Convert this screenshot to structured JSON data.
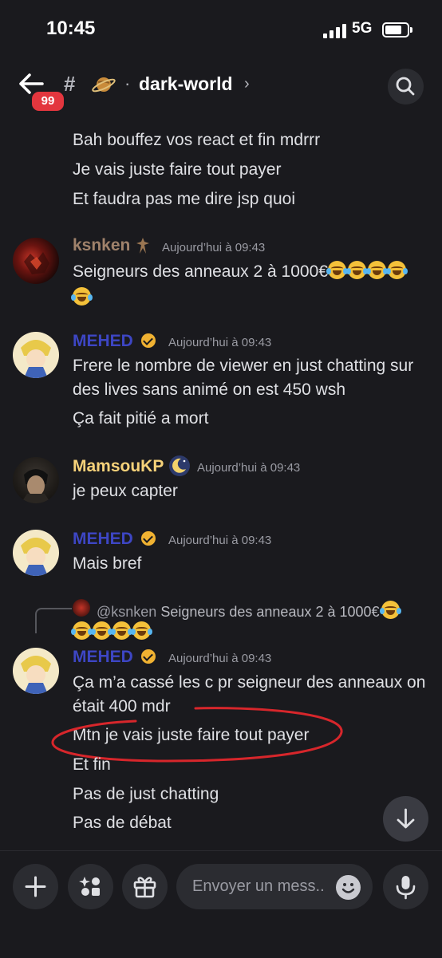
{
  "status_bar": {
    "time": "10:45",
    "network": "5G"
  },
  "header": {
    "unread_badge": "99",
    "channel_name": "dark-world",
    "hash_symbol": "#",
    "separator": "·",
    "chevron": "›"
  },
  "top_lines": [
    "Bah bouffez vos react et fin mdrrr",
    "Je vais juste faire tout payer",
    "Et faudra pas me dire jsp quoi"
  ],
  "messages": [
    {
      "author": "ksnken",
      "author_color": "#a0826b",
      "timestamp": "Aujourd’hui à 09:43",
      "lines": [
        "Seigneurs des anneaux 2 à 1000€"
      ]
    },
    {
      "author": "MEHED",
      "author_color": "#3d46c4",
      "timestamp": "Aujourd’hui à 09:43",
      "lines": [
        "Frere le nombre de viewer en just chatting sur",
        "des lives sans animé on est 450 wsh",
        "Ça fait pitié a mort"
      ]
    },
    {
      "author": "MamsouKP",
      "author_color": "#f6d27a",
      "timestamp": "Aujourd’hui à 09:43",
      "lines": [
        "je peux capter"
      ]
    },
    {
      "author": "MEHED",
      "author_color": "#3d46c4",
      "timestamp": "Aujourd’hui à 09:43",
      "lines": [
        "Mais bref"
      ]
    },
    {
      "author": "MEHED",
      "author_color": "#3d46c4",
      "timestamp": "Aujourd’hui à 09:43",
      "reply": {
        "mention": "@ksnken",
        "text": "Seigneurs des anneaux 2 à 1000€"
      },
      "lines": [
        "Ça m’a cassé les c pr seigneur des anneaux on",
        "était 400 mdr",
        "Mtn je vais juste faire tout payer",
        "Et fin",
        "Pas de just chatting",
        "Pas de débat"
      ]
    }
  ],
  "composer": {
    "placeholder": "Envoyer un mess.."
  },
  "colors": {
    "background": "#1a1a1e",
    "annotation_red": "#d7262b",
    "badge_red": "#e3363e",
    "verified_gold": "#f0b232"
  },
  "icons": [
    "back-arrow-icon",
    "hash-icon",
    "planet-icon",
    "search-icon",
    "plus-icon",
    "apps-icon",
    "gift-icon",
    "emoji-icon",
    "mic-icon",
    "arrow-down-icon"
  ]
}
